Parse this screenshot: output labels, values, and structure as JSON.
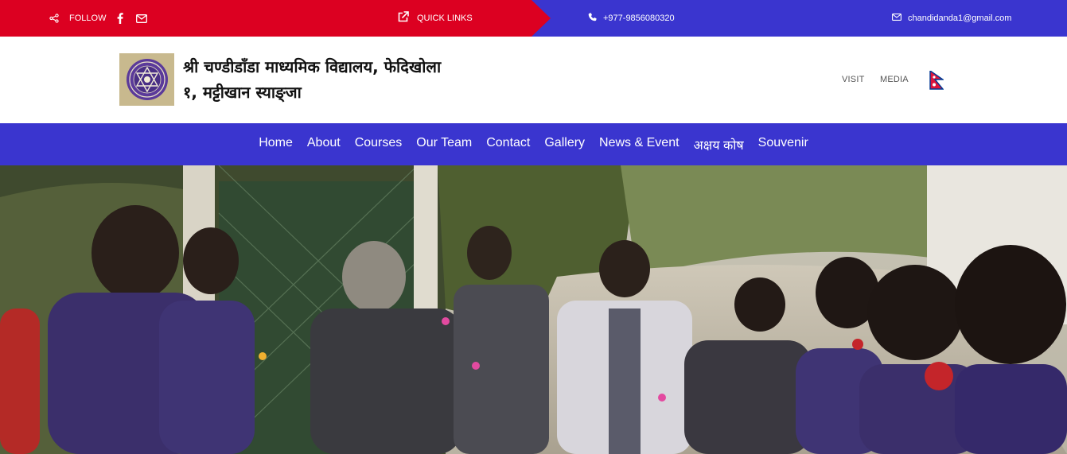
{
  "topbar": {
    "follow_label": "FOLLOW",
    "social_icons": [
      "share-icon",
      "facebook-icon",
      "mail-icon"
    ],
    "quick_links_label": "QUICK LINKS",
    "phone": "+977-9856080320",
    "email": "chandidanda1@gmail.com",
    "colors": {
      "red": "#dc0021",
      "blue": "#3a35cf"
    }
  },
  "header": {
    "school_name_line1": "श्री चण्डीडाँडा माध्यमिक विद्यालय, फेदिखोला",
    "school_name_line2": "१, मट्टीखान स्याङ्जा",
    "visit_label": "VISIT",
    "media_label": "MEDIA"
  },
  "nav": {
    "items": [
      {
        "label": "Home"
      },
      {
        "label": "About"
      },
      {
        "label": "Courses"
      },
      {
        "label": "Our Team"
      },
      {
        "label": "Contact"
      },
      {
        "label": "Gallery"
      },
      {
        "label": "News & Event"
      },
      {
        "label": "अक्षय कोष"
      },
      {
        "label": "Souvenir"
      }
    ]
  }
}
